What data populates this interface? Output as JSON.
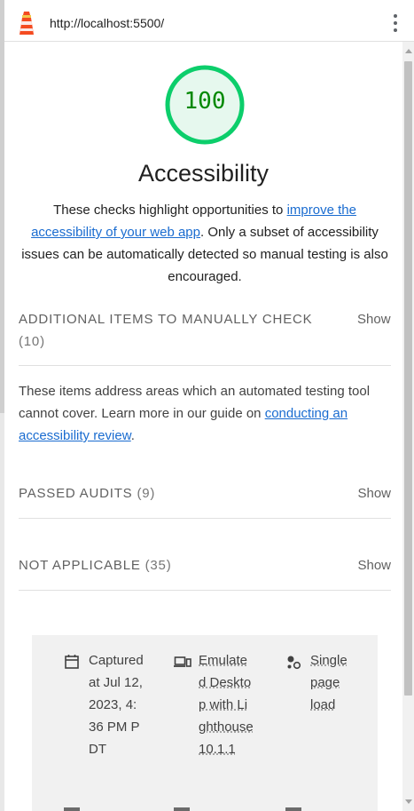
{
  "topbar": {
    "url": "http://localhost:5500/"
  },
  "category": {
    "score": "100",
    "title": "Accessibility",
    "description_prefix": "These checks highlight opportunities to ",
    "description_link": "improve the accessibility of your web app",
    "description_suffix": ". Only a subset of accessibility issues can be automatically detected so manual testing is also encouraged."
  },
  "groups": [
    {
      "title": "ADDITIONAL ITEMS TO MANUALLY CHECK",
      "count": "(10)",
      "toggle": "Show"
    },
    {
      "title": "PASSED AUDITS",
      "count": "(9)",
      "toggle": "Show"
    },
    {
      "title": "NOT APPLICABLE",
      "count": "(35)",
      "toggle": "Show"
    }
  ],
  "manual_description": {
    "prefix": "These items address areas which an automated testing tool cannot cover. Learn more in our guide on ",
    "link": "conducting an accessibility review",
    "suffix": "."
  },
  "environment": [
    {
      "icon": "calendar-icon",
      "text": "Captured at Jul 12, 2023, 4:36 PM PDT"
    },
    {
      "icon": "devices-icon",
      "text": "Emulated Desktop with Lighthouse 10.1.1"
    },
    {
      "icon": "single-page-load-icon",
      "text": "Single page load"
    }
  ],
  "colors": {
    "pass": "#0cce6b",
    "pass_text": "#008800",
    "link": "#1a6cd0"
  }
}
